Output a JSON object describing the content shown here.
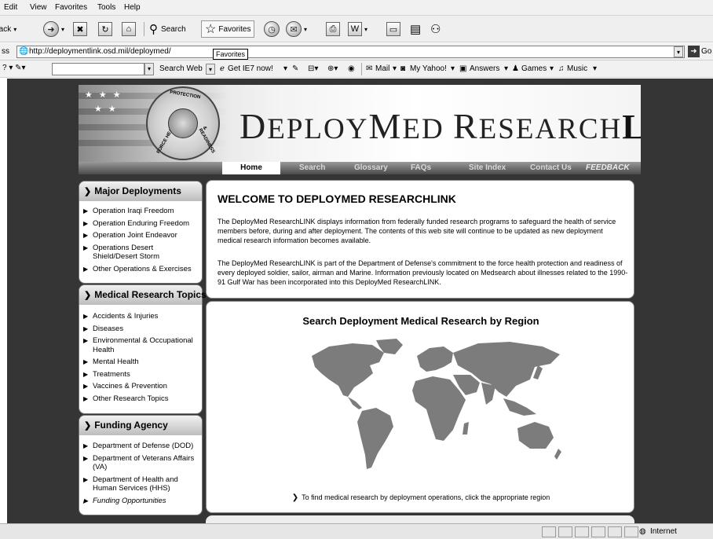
{
  "browser": {
    "menu": [
      "Edit",
      "View",
      "Favorites",
      "Tools",
      "Help"
    ],
    "toolbar": {
      "back": "Back",
      "search": "Search",
      "favorites": "Favorites"
    },
    "tooltip": "Favorites",
    "address": {
      "label": "ss",
      "url": "http://deploymentlink.osd.mil/deploymed/",
      "go": "Go"
    },
    "links": {
      "search_web": "Search Web",
      "get_ie7": "Get IE7 now!",
      "mail": "Mail",
      "my_yahoo": "My Yahoo!",
      "answers": "Answers",
      "games": "Games",
      "music": "Music"
    },
    "status": {
      "zone": "Internet"
    }
  },
  "site": {
    "seal": {
      "top": "PROTECTION",
      "left": "FORCE HEALTH",
      "right": "& READINESS"
    },
    "title": {
      "part1_cap": "D",
      "part1": "EPLOY",
      "part2_cap": "M",
      "part2": "ED",
      "part3_cap": "R",
      "part3": "ESEARCH",
      "part4": "LINK"
    },
    "nav": [
      "Home",
      "Search",
      "Glossary",
      "FAQs",
      "Site Index",
      "Contact Us",
      "FEEDBACK"
    ],
    "sidebar": {
      "major": {
        "title": "Major Deployments",
        "items": [
          "Operation Iraqi Freedom",
          "Operation Enduring Freedom",
          "Operation Joint Endeavor",
          "Operations Desert Shield/Desert Storm",
          "Other Operations & Exercises"
        ]
      },
      "medical": {
        "title": "Medical Research Topics",
        "items": [
          "Accidents & Injuries",
          "Diseases",
          "Environmental & Occupational Health",
          "Mental Health",
          "Treatments",
          "Vaccines & Prevention",
          "Other Research Topics"
        ]
      },
      "funding": {
        "title": "Funding Agency",
        "items": [
          "Department of Defense (DOD)",
          "Department of Veterans Affairs (VA)",
          "Department of Health and Human Services (HHS)",
          "Funding Opportunities"
        ]
      }
    },
    "welcome": {
      "heading": "WELCOME TO DEPLOYMED RESEARCHLINK",
      "p1": "The DeployMed ResearchLINK displays information from federally funded research programs to safeguard the health of service members before, during and after deployment. The contents of this web site will continue to be updated as new deployment medical research information becomes available.",
      "p2": "The DeployMed ResearchLINK is part of the Department of Defense's commitment to the force health protection and readiness of every deployed soldier, sailor, airman and Marine. Information previously located on Medsearch about illnesses related to the 1990-91 Gulf War has been incorporated into this DeployMed ResearchLINK."
    },
    "region": {
      "title": "Search Deployment Medical Research by Region",
      "hint": "To find medical research by deployment operations, click the appropriate region"
    }
  }
}
